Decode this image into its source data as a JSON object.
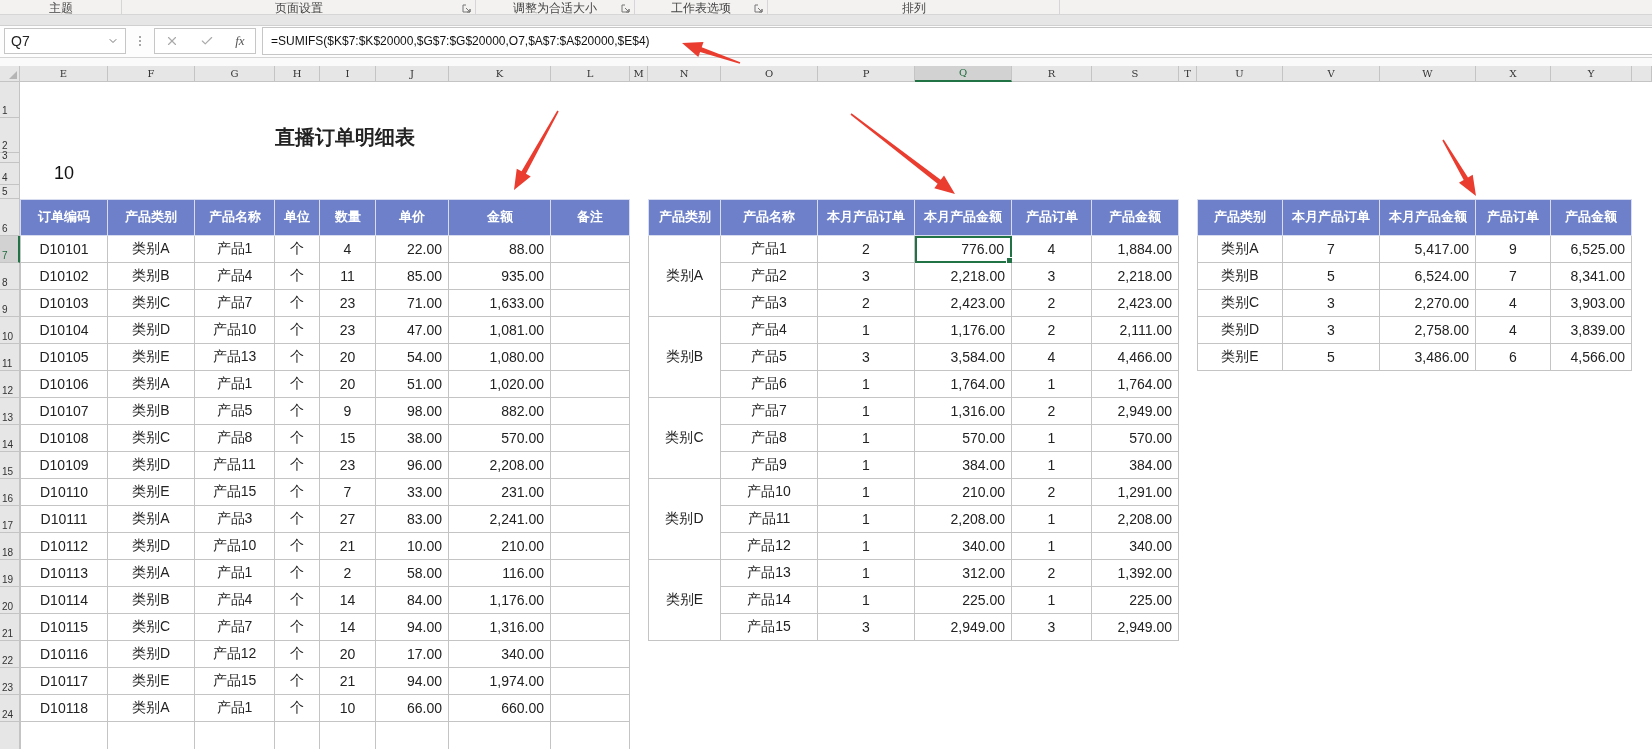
{
  "ribbon_groups": [
    {
      "label": "主题",
      "launcher": false
    },
    {
      "label": "页面设置",
      "launcher": true
    },
    {
      "label": "调整为合适大小",
      "launcher": true
    },
    {
      "label": "工作表选项",
      "launcher": true
    },
    {
      "label": "排列",
      "launcher": false
    }
  ],
  "name_box": "Q7",
  "function_label": "fx",
  "formula": "=SUMIFS($K$7:$K$20000,$G$7:$G$20000,O7,$A$7:$A$20000,$E$4)",
  "column_headers": [
    {
      "label": "E",
      "selected": false
    },
    {
      "label": "F",
      "selected": false
    },
    {
      "label": "G",
      "selected": false
    },
    {
      "label": "H",
      "selected": false
    },
    {
      "label": "I",
      "selected": false
    },
    {
      "label": "J",
      "selected": false
    },
    {
      "label": "K",
      "selected": false
    },
    {
      "label": "L",
      "selected": false
    },
    {
      "label": "M",
      "selected": false
    },
    {
      "label": "N",
      "selected": false
    },
    {
      "label": "O",
      "selected": false
    },
    {
      "label": "P",
      "selected": false
    },
    {
      "label": "Q",
      "selected": true
    },
    {
      "label": "R",
      "selected": false
    },
    {
      "label": "S",
      "selected": false
    },
    {
      "label": "T",
      "selected": false
    },
    {
      "label": "U",
      "selected": false
    },
    {
      "label": "V",
      "selected": false
    },
    {
      "label": "W",
      "selected": false
    },
    {
      "label": "X",
      "selected": false
    },
    {
      "label": "Y",
      "selected": false
    }
  ],
  "row_headers": [
    {
      "label": "1",
      "selected": false
    },
    {
      "label": "2",
      "selected": false
    },
    {
      "label": "3",
      "selected": false
    },
    {
      "label": "4",
      "selected": false
    },
    {
      "label": "5",
      "selected": false
    },
    {
      "label": "6",
      "selected": false
    },
    {
      "label": "7",
      "selected": true
    },
    {
      "label": "8",
      "selected": false
    },
    {
      "label": "9",
      "selected": false
    },
    {
      "label": "10",
      "selected": false
    },
    {
      "label": "11",
      "selected": false
    },
    {
      "label": "12",
      "selected": false
    },
    {
      "label": "13",
      "selected": false
    },
    {
      "label": "14",
      "selected": false
    },
    {
      "label": "15",
      "selected": false
    },
    {
      "label": "16",
      "selected": false
    },
    {
      "label": "17",
      "selected": false
    },
    {
      "label": "18",
      "selected": false
    },
    {
      "label": "19",
      "selected": false
    },
    {
      "label": "20",
      "selected": false
    },
    {
      "label": "21",
      "selected": false
    },
    {
      "label": "22",
      "selected": false
    },
    {
      "label": "23",
      "selected": false
    },
    {
      "label": "24",
      "selected": false
    }
  ],
  "title": "直播订单明细表",
  "cell_e4": "10",
  "orders": {
    "columns": [
      "订单编码",
      "产品类别",
      "产品名称",
      "单位",
      "数量",
      "单价",
      "金额",
      "备注"
    ],
    "rows": [
      [
        "D10101",
        "类别A",
        "产品1",
        "个",
        "4",
        "22.00",
        "88.00"
      ],
      [
        "D10102",
        "类别B",
        "产品4",
        "个",
        "11",
        "85.00",
        "935.00"
      ],
      [
        "D10103",
        "类别C",
        "产品7",
        "个",
        "23",
        "71.00",
        "1,633.00"
      ],
      [
        "D10104",
        "类别D",
        "产品10",
        "个",
        "23",
        "47.00",
        "1,081.00"
      ],
      [
        "D10105",
        "类别E",
        "产品13",
        "个",
        "20",
        "54.00",
        "1,080.00"
      ],
      [
        "D10106",
        "类别A",
        "产品1",
        "个",
        "20",
        "51.00",
        "1,020.00"
      ],
      [
        "D10107",
        "类别B",
        "产品5",
        "个",
        "9",
        "98.00",
        "882.00"
      ],
      [
        "D10108",
        "类别C",
        "产品8",
        "个",
        "15",
        "38.00",
        "570.00"
      ],
      [
        "D10109",
        "类别D",
        "产品11",
        "个",
        "23",
        "96.00",
        "2,208.00"
      ],
      [
        "D10110",
        "类别E",
        "产品15",
        "个",
        "7",
        "33.00",
        "231.00"
      ],
      [
        "D10111",
        "类别A",
        "产品3",
        "个",
        "27",
        "83.00",
        "2,241.00"
      ],
      [
        "D10112",
        "类别D",
        "产品10",
        "个",
        "21",
        "10.00",
        "210.00"
      ],
      [
        "D10113",
        "类别A",
        "产品1",
        "个",
        "2",
        "58.00",
        "116.00"
      ],
      [
        "D10114",
        "类别B",
        "产品4",
        "个",
        "14",
        "84.00",
        "1,176.00"
      ],
      [
        "D10115",
        "类别C",
        "产品7",
        "个",
        "14",
        "94.00",
        "1,316.00"
      ],
      [
        "D10116",
        "类别D",
        "产品12",
        "个",
        "20",
        "17.00",
        "340.00"
      ],
      [
        "D10117",
        "类别E",
        "产品15",
        "个",
        "21",
        "94.00",
        "1,974.00"
      ],
      [
        "D10118",
        "类别A",
        "产品1",
        "个",
        "10",
        "66.00",
        "660.00"
      ]
    ]
  },
  "product_summary": {
    "columns": [
      "产品类别",
      "产品名称",
      "本月产品订单",
      "本月产品金额",
      "产品订单",
      "产品金额"
    ],
    "groups": [
      {
        "category": "类别A",
        "products": [
          {
            "name": "产品1",
            "cells": [
              "2",
              "776.00",
              "4",
              "1,884.00"
            ],
            "selected": true
          },
          {
            "name": "产品2",
            "cells": [
              "3",
              "2,218.00",
              "3",
              "2,218.00"
            ],
            "selected": false
          },
          {
            "name": "产品3",
            "cells": [
              "2",
              "2,423.00",
              "2",
              "2,423.00"
            ],
            "selected": false
          }
        ]
      },
      {
        "category": "类别B",
        "products": [
          {
            "name": "产品4",
            "cells": [
              "1",
              "1,176.00",
              "2",
              "2,111.00"
            ],
            "selected": false
          },
          {
            "name": "产品5",
            "cells": [
              "3",
              "3,584.00",
              "4",
              "4,466.00"
            ],
            "selected": false
          },
          {
            "name": "产品6",
            "cells": [
              "1",
              "1,764.00",
              "1",
              "1,764.00"
            ],
            "selected": false
          }
        ]
      },
      {
        "category": "类别C",
        "products": [
          {
            "name": "产品7",
            "cells": [
              "1",
              "1,316.00",
              "2",
              "2,949.00"
            ],
            "selected": false
          },
          {
            "name": "产品8",
            "cells": [
              "1",
              "570.00",
              "1",
              "570.00"
            ],
            "selected": false
          },
          {
            "name": "产品9",
            "cells": [
              "1",
              "384.00",
              "1",
              "384.00"
            ],
            "selected": false
          }
        ]
      },
      {
        "category": "类别D",
        "products": [
          {
            "name": "产品10",
            "cells": [
              "1",
              "210.00",
              "2",
              "1,291.00"
            ],
            "selected": false
          },
          {
            "name": "产品11",
            "cells": [
              "1",
              "2,208.00",
              "1",
              "2,208.00"
            ],
            "selected": false
          },
          {
            "name": "产品12",
            "cells": [
              "1",
              "340.00",
              "1",
              "340.00"
            ],
            "selected": false
          }
        ]
      },
      {
        "category": "类别E",
        "products": [
          {
            "name": "产品13",
            "cells": [
              "1",
              "312.00",
              "2",
              "1,392.00"
            ],
            "selected": false
          },
          {
            "name": "产品14",
            "cells": [
              "1",
              "225.00",
              "1",
              "225.00"
            ],
            "selected": false
          },
          {
            "name": "产品15",
            "cells": [
              "3",
              "2,949.00",
              "3",
              "2,949.00"
            ],
            "selected": false
          }
        ]
      }
    ]
  },
  "category_summary": {
    "columns": [
      "产品类别",
      "本月产品订单",
      "本月产品金额",
      "产品订单",
      "产品金额"
    ],
    "rows": [
      [
        "类别A",
        "7",
        "5,417.00",
        "9",
        "6,525.00"
      ],
      [
        "类别B",
        "5",
        "6,524.00",
        "7",
        "8,341.00"
      ],
      [
        "类别C",
        "3",
        "2,270.00",
        "4",
        "3,903.00"
      ],
      [
        "类别D",
        "3",
        "2,758.00",
        "4",
        "3,839.00"
      ],
      [
        "类别E",
        "5",
        "3,486.00",
        "6",
        "4,566.00"
      ]
    ]
  }
}
